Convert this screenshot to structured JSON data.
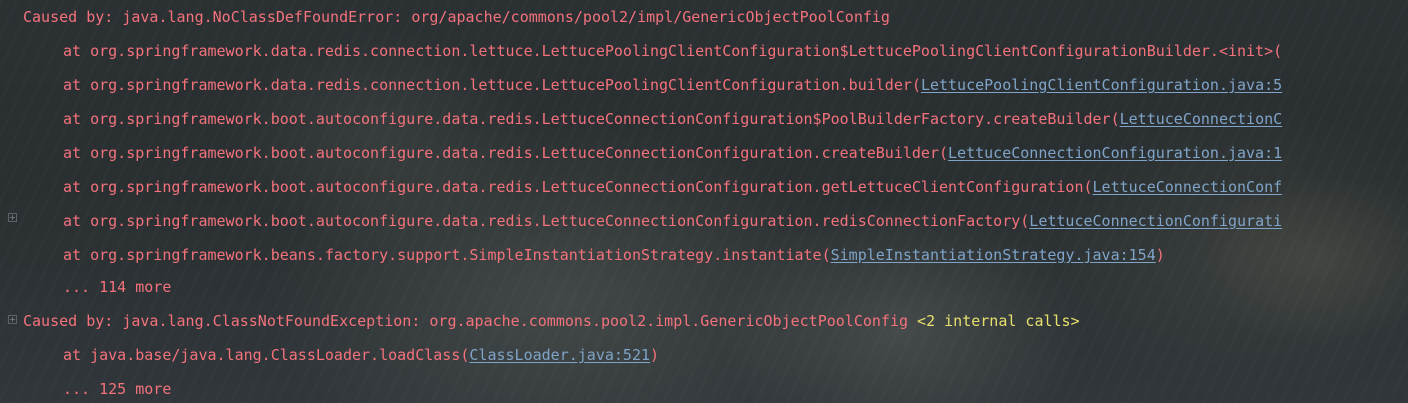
{
  "console": {
    "line0": {
      "text": "Caused by: java.lang.NoClassDefFoundError: org/apache/commons/pool2/impl/GenericObjectPoolConfig"
    },
    "line1": {
      "prefix": "at org.springframework.data.redis.connection.lettuce.LettucePoolingClientConfiguration$LettucePoolingClientConfigurationBuilder.<init>("
    },
    "line2": {
      "prefix": "at org.springframework.data.redis.connection.lettuce.LettucePoolingClientConfiguration.builder(",
      "link": "LettucePoolingClientConfiguration.java:5"
    },
    "line3": {
      "prefix": "at org.springframework.boot.autoconfigure.data.redis.LettuceConnectionConfiguration$PoolBuilderFactory.createBuilder(",
      "link": "LettuceConnectionC"
    },
    "line4": {
      "prefix": "at org.springframework.boot.autoconfigure.data.redis.LettuceConnectionConfiguration.createBuilder(",
      "link": "LettuceConnectionConfiguration.java:1"
    },
    "line5": {
      "prefix": "at org.springframework.boot.autoconfigure.data.redis.LettuceConnectionConfiguration.getLettuceClientConfiguration(",
      "link": "LettuceConnectionConf"
    },
    "line6": {
      "prefix": "at org.springframework.boot.autoconfigure.data.redis.LettuceConnectionConfiguration.redisConnectionFactory(",
      "link": "LettuceConnectionConfigurati"
    },
    "line7": {
      "prefix": "at org.springframework.beans.factory.support.SimpleInstantiationStrategy.instantiate(",
      "link": "SimpleInstantiationStrategy.java:154",
      "suffix": ")"
    },
    "line8": {
      "text": "... 114 more"
    },
    "line9": {
      "text": "Caused by: java.lang.ClassNotFoundException: org.apache.commons.pool2.impl.GenericObjectPoolConfig",
      "internal": "<2 internal calls>"
    },
    "line10": {
      "prefix": "at java.base/java.lang.ClassLoader.loadClass(",
      "link": "ClassLoader.java:521",
      "suffix": ")"
    },
    "line11": {
      "text": "... 125 more"
    }
  },
  "colors": {
    "error_text": "#f4727c",
    "link": "#7fa4c8",
    "internal_calls": "#e6e06d",
    "background": "#262b2e"
  },
  "icons": [
    "expand-fold-icon",
    "expand-fold-icon"
  ]
}
